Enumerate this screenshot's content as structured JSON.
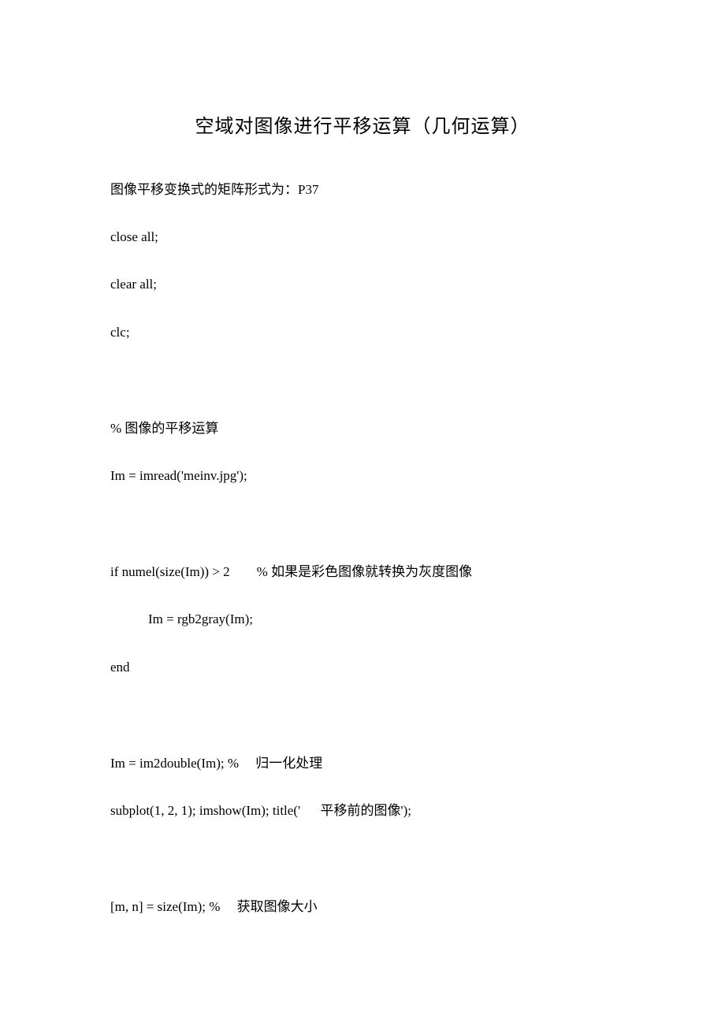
{
  "document": {
    "title": "空域对图像进行平移运算（几何运算）",
    "lines": [
      "图像平移变换式的矩阵形式为：P37",
      "close all;",
      "clear all;",
      "clc;",
      "% 图像的平移运算",
      "Im = imread('meinv.jpg');",
      "if numel(size(Im)) > 2        % 如果是彩色图像就转换为灰度图像",
      "Im = rgb2gray(Im);",
      "end",
      "Im = im2double(Im); %     归一化处理",
      "subplot(1, 2, 1); imshow(Im); title('      平移前的图像');",
      "[m, n] = size(Im); %     获取图像大小"
    ]
  }
}
